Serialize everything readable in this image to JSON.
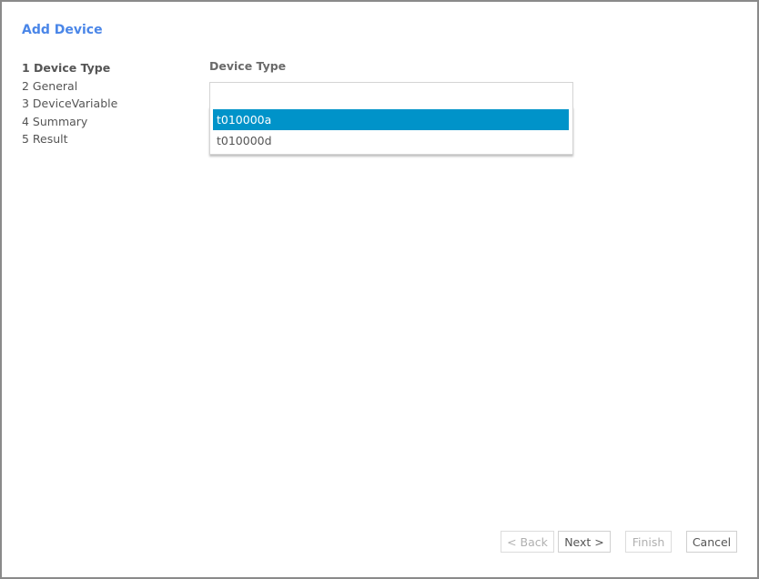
{
  "dialog": {
    "title": "Add Device"
  },
  "steps": [
    {
      "label": "1 Device Type",
      "active": true
    },
    {
      "label": "2 General",
      "active": false
    },
    {
      "label": "3 DeviceVariable",
      "active": false
    },
    {
      "label": "4 Summary",
      "active": false
    },
    {
      "label": "5 Result",
      "active": false
    }
  ],
  "form": {
    "device_type_label": "Device Type",
    "device_type_value": "",
    "options": [
      {
        "label": "t010000a",
        "highlighted": true
      },
      {
        "label": "t010000d",
        "highlighted": false
      }
    ]
  },
  "buttons": {
    "back": {
      "label": "< Back",
      "enabled": false
    },
    "next": {
      "label": "Next >",
      "enabled": true
    },
    "finish": {
      "label": "Finish",
      "enabled": false
    },
    "cancel": {
      "label": "Cancel",
      "enabled": true
    }
  },
  "colors": {
    "title": "#4a86e8",
    "highlight": "#0093c9"
  }
}
